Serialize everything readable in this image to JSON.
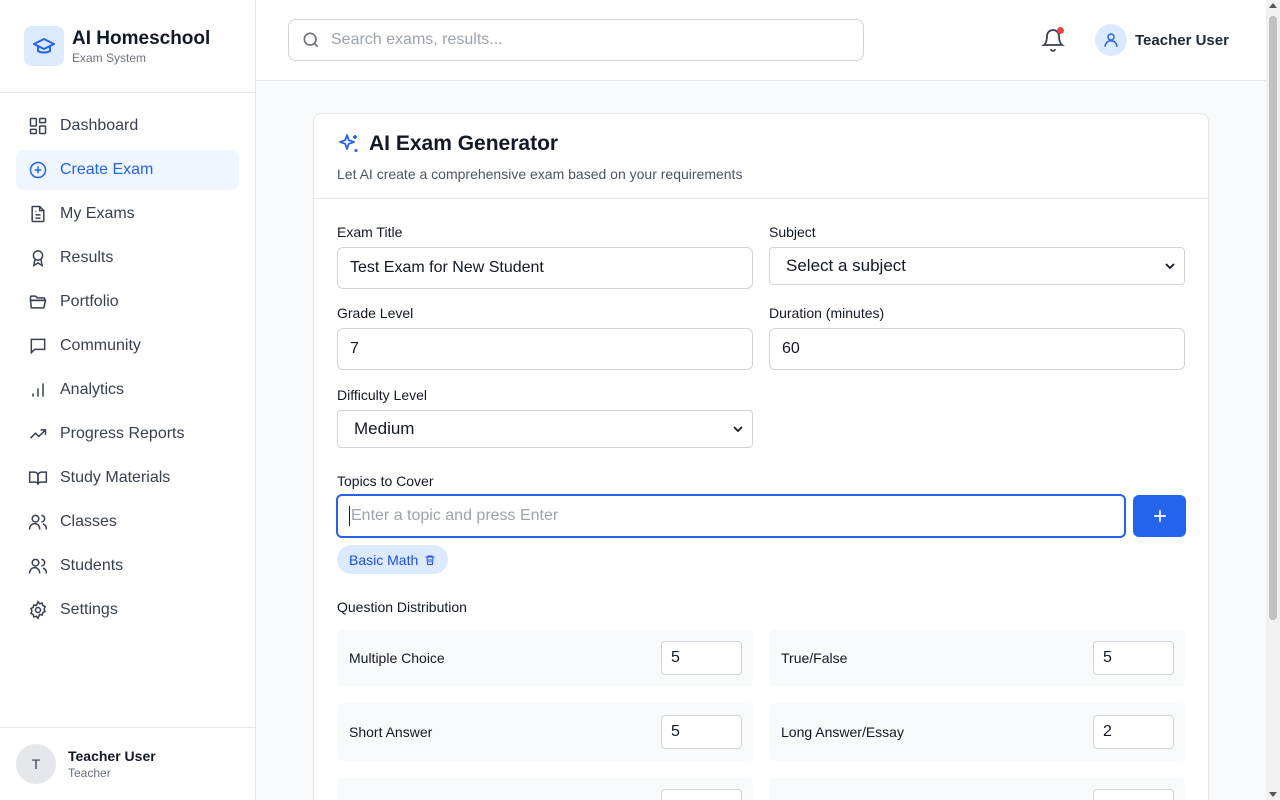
{
  "brand": {
    "title": "AI Homeschool",
    "subtitle": "Exam System"
  },
  "nav": [
    {
      "label": "Dashboard",
      "icon": "dashboard-icon",
      "active": false
    },
    {
      "label": "Create Exam",
      "icon": "plus-circle-icon",
      "active": true
    },
    {
      "label": "My Exams",
      "icon": "document-icon",
      "active": false
    },
    {
      "label": "Results",
      "icon": "award-icon",
      "active": false
    },
    {
      "label": "Portfolio",
      "icon": "folder-icon",
      "active": false
    },
    {
      "label": "Community",
      "icon": "message-icon",
      "active": false
    },
    {
      "label": "Analytics",
      "icon": "bar-chart-icon",
      "active": false
    },
    {
      "label": "Progress Reports",
      "icon": "trending-up-icon",
      "active": false
    },
    {
      "label": "Study Materials",
      "icon": "book-icon",
      "active": false
    },
    {
      "label": "Classes",
      "icon": "users-icon",
      "active": false
    },
    {
      "label": "Students",
      "icon": "users-icon",
      "active": false
    },
    {
      "label": "Settings",
      "icon": "gear-icon",
      "active": false
    }
  ],
  "sidebar_user": {
    "initial": "T",
    "name": "Teacher User",
    "role": "Teacher"
  },
  "header": {
    "search_placeholder": "Search exams, results...",
    "user_name": "Teacher User",
    "notification_dot_color": "#ef4444"
  },
  "form": {
    "title": "AI Exam Generator",
    "subtitle": "Let AI create a comprehensive exam based on your requirements",
    "exam_title_label": "Exam Title",
    "exam_title_value": "Test Exam for New Student",
    "subject_label": "Subject",
    "subject_value": "Select a subject",
    "grade_label": "Grade Level",
    "grade_value": "7",
    "duration_label": "Duration (minutes)",
    "duration_value": "60",
    "difficulty_label": "Difficulty Level",
    "difficulty_value": "Medium",
    "topics_label": "Topics to Cover",
    "topics_placeholder": "Enter a topic and press Enter",
    "topics": [
      "Basic Math"
    ],
    "distribution_label": "Question Distribution",
    "distribution": [
      {
        "label": "Multiple Choice",
        "value": "5"
      },
      {
        "label": "True/False",
        "value": "5"
      },
      {
        "label": "Short Answer",
        "value": "5"
      },
      {
        "label": "Long Answer/Essay",
        "value": "2"
      }
    ]
  },
  "colors": {
    "accent": "#2563eb",
    "accent_light": "#eff6ff",
    "chip_bg": "#dbeafe"
  }
}
